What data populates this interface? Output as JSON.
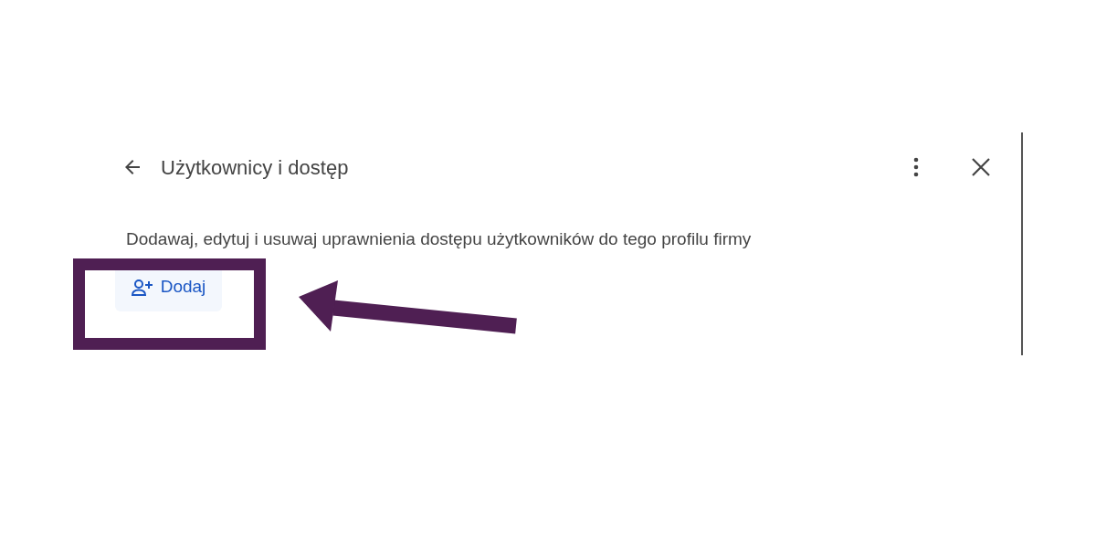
{
  "dialog": {
    "title": "Użytkownicy i dostęp",
    "description": "Dodawaj, edytuj i usuwaj uprawnienia dostępu użytkowników do tego profilu firmy",
    "add_button": {
      "label": "Dodaj"
    }
  }
}
